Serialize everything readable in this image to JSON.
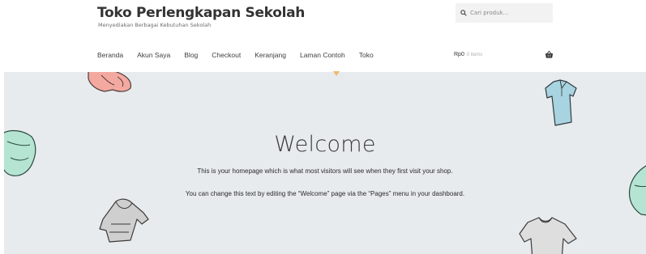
{
  "site": {
    "title": "Toko Perlengkapan Sekolah",
    "description": "Menyediakan Berbagai Kebutuhan Sekolah"
  },
  "search": {
    "placeholder": "Cari produk..."
  },
  "nav": {
    "items": [
      "Beranda",
      "Akun Saya",
      "Blog",
      "Checkout",
      "Keranjang",
      "Laman Contoh",
      "Toko"
    ]
  },
  "cart": {
    "amount": "Rp0",
    "count": "0 items",
    "icon": "basket-icon"
  },
  "hero": {
    "heading": "Welcome",
    "line1": "This is your homepage which is what most visitors will see when they first visit your shop.",
    "line2": "You can change this text by editing the “Welcome” page via the “Pages” menu in your dashboard.",
    "background_color": "#e7ebee"
  },
  "colors": {
    "pink_garment": "#f4a9a0",
    "blue_shirt": "#a8d3e0",
    "green_hoodie": "#b5e4d3",
    "grey_hoodie": "#cfcfcf",
    "caret": "#f0b86a"
  }
}
